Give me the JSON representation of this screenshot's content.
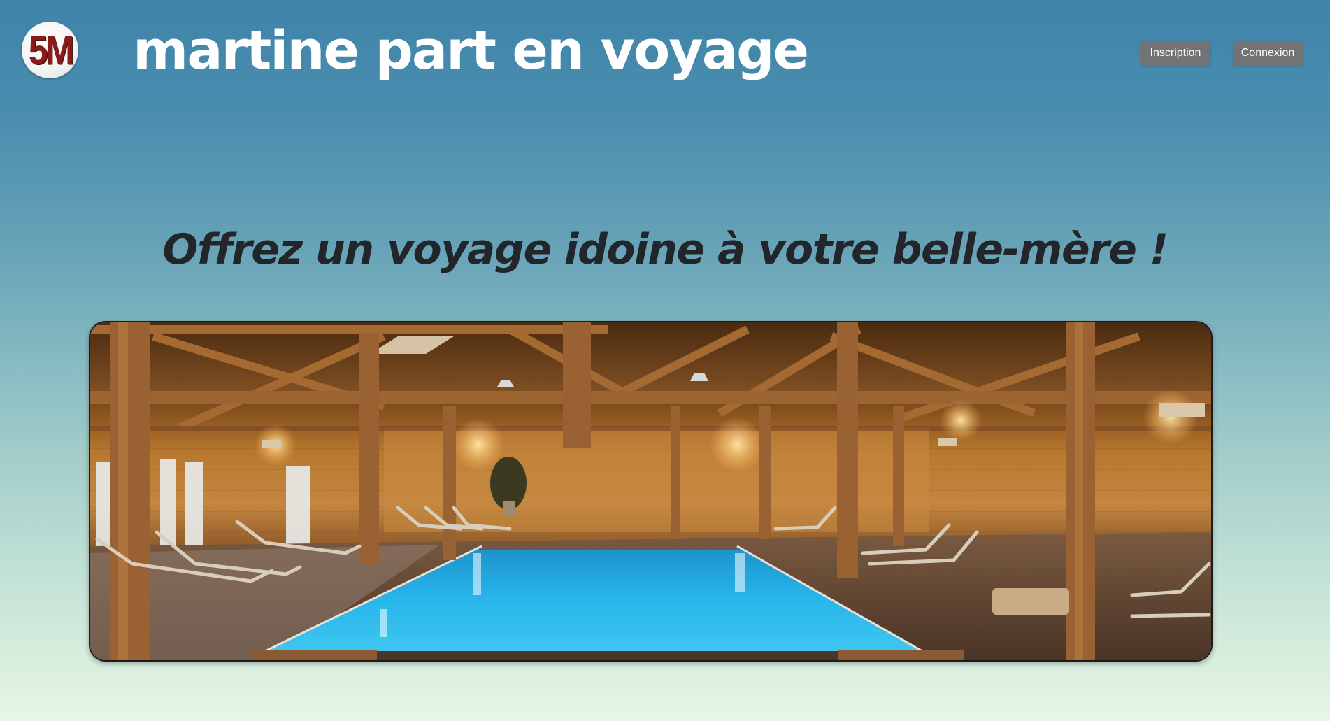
{
  "header": {
    "logo_text": "5M",
    "site_title": "martine part en voyage",
    "buttons": {
      "signup_label": "Inscription",
      "login_label": "Connexion"
    }
  },
  "hero": {
    "heading": "Offrez un voyage idoine à votre belle-mère !",
    "image_subject": "indoor swimming pool in a wooden chalet with lounge chairs"
  },
  "colors": {
    "background_top": "#3f84a9",
    "background_bottom": "#e7f6e4",
    "title_color": "#ffffff",
    "heading_color": "#222529",
    "button_bg": "#727374",
    "logo_red": "#8b1a1a",
    "pool_water": "#23aee6",
    "wood": "#b0753a"
  }
}
